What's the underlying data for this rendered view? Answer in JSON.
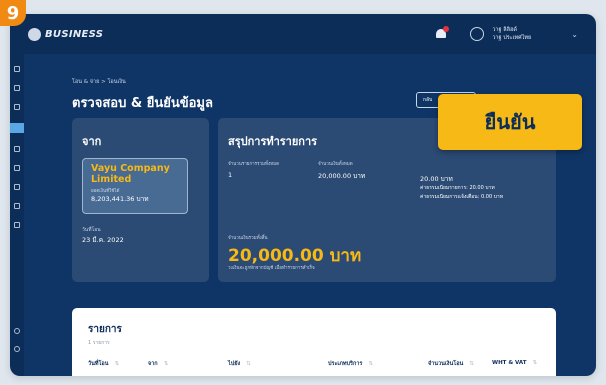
{
  "step_badge": "9",
  "header": {
    "brand_small": "",
    "brand": "BUSINESS",
    "user_name": "วาฐ ลิลิฮด์",
    "user_company": "วาฐ ประเทศไทย"
  },
  "breadcrumb": "โอน & จ่าย > โอนเงิน",
  "page_title": "ตรวจสอบ & ยืนยันข้อมูล",
  "back_button": "กลับ",
  "from_card": {
    "title": "จาก",
    "account_name": "Vayu Company Limited",
    "balance_label": "ยอดเงินที่ใช้ได้",
    "balance": "8,203,441.36 บาท",
    "date_label": "วันที่โอน",
    "date": "23 มี.ค. 2022"
  },
  "summary_card": {
    "title": "สรุปการทำรายการ",
    "count_label": "จำนวนรายการรวมทั้งหมด",
    "count": "1",
    "amount_label": "จำนวนเงินทั้งหมด",
    "amount": "20,000.00 บาท",
    "fee_value": "20.00 บาท",
    "fee_line": "ค่าธรรมเนียมรายการ: 20.00 บาท",
    "vat_line": "ค่าธรรมเนียมการแจ้งเตือน: 0.00 บาท",
    "total_label": "จำนวนเงินรวมทั้งสิ้น",
    "total": "20,000.00 บาท",
    "total_note": "วงเงินจะถูกหักจากบัญชี เมื่อทำรายการสำเร็จ"
  },
  "confirm_button": "ยืนยัน",
  "list": {
    "title": "รายการ",
    "count": "1 รายการ",
    "columns": [
      "วันที่โอน",
      "จาก",
      "ไปยัง",
      "ประเภทบริการ",
      "จำนวนเงินโอน",
      "WHT & VAT"
    ]
  },
  "colors": {
    "navy": "#0b2d58",
    "card": "#2b4a74",
    "accent_yellow": "#f7b916",
    "step_orange": "#f08a12"
  }
}
